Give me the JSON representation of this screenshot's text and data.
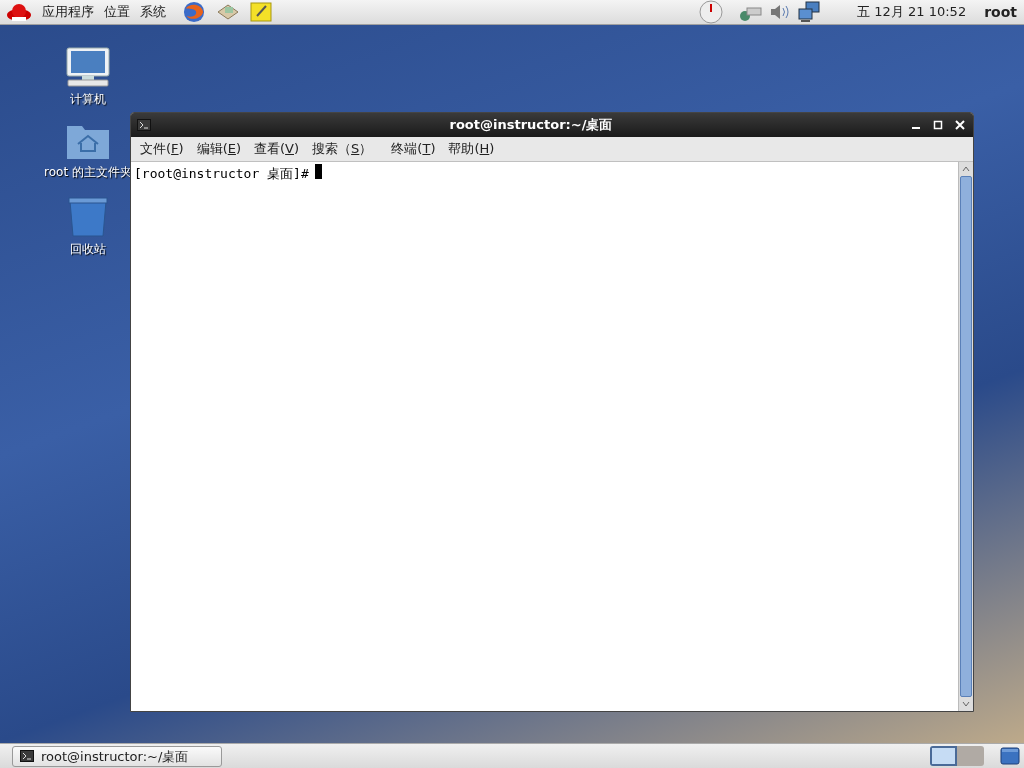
{
  "top_panel": {
    "menus": [
      "应用程序",
      "位置",
      "系统"
    ],
    "clock": "五 12月 21 10:52",
    "user": "root"
  },
  "desktop_icons": [
    {
      "kind": "computer",
      "label": "计算机"
    },
    {
      "kind": "home",
      "label": "root 的主文件夹"
    },
    {
      "kind": "trash",
      "label": "回收站"
    }
  ],
  "window": {
    "title": "root@instructor:~/桌面",
    "menu": [
      {
        "text": "文件(",
        "mnemonic": "F",
        "rest": ")"
      },
      {
        "text": "编辑(",
        "mnemonic": "E",
        "rest": ")"
      },
      {
        "text": "查看(",
        "mnemonic": "V",
        "rest": ")"
      },
      {
        "text": "搜索（",
        "mnemonic": "S",
        "rest": "）"
      },
      {
        "text": "终端(",
        "mnemonic": "T",
        "rest": ")"
      },
      {
        "text": "帮助(",
        "mnemonic": "H",
        "rest": ")"
      }
    ],
    "prompt": "[root@instructor 桌面]#"
  },
  "taskbar": {
    "tasks": [
      {
        "label": "root@instructor:~/桌面",
        "selected": false
      }
    ],
    "workspaces": [
      {
        "selected": true
      },
      {
        "selected": false
      }
    ]
  }
}
